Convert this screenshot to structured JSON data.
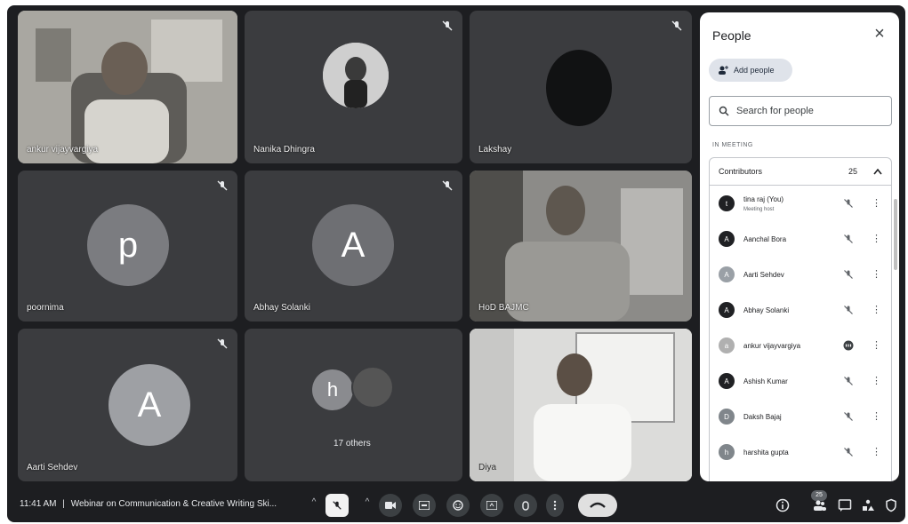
{
  "tiles": [
    {
      "name": "ankur vijayvargiya"
    },
    {
      "name": "Nanika Dhingra"
    },
    {
      "name": "Lakshay"
    },
    {
      "name": "poornima",
      "initial": "p"
    },
    {
      "name": "Abhay Solanki",
      "initial": "A"
    },
    {
      "name": "HoD BAJMC"
    },
    {
      "name": "Aarti Sehdev",
      "initial": "A"
    },
    {
      "name": "17 others",
      "initial": "h"
    },
    {
      "name": "Diya"
    }
  ],
  "people_panel": {
    "title": "People",
    "close": "×",
    "add_people": "Add people",
    "search_placeholder": "Search for people",
    "in_meeting": "IN MEETING",
    "section": "Contributors",
    "count": "25",
    "participants": [
      {
        "name": "tina raj (You)",
        "sub": "Meeting host",
        "initial": "t",
        "color": "#202124",
        "status": "muted"
      },
      {
        "name": "Aanchal Bora",
        "initial": "A",
        "color": "#202124",
        "status": "muted"
      },
      {
        "name": "Aarti Sehdev",
        "initial": "A",
        "color": "#9aa0a6",
        "status": "muted"
      },
      {
        "name": "Abhay Solanki",
        "initial": "A",
        "color": "#202124",
        "status": "muted"
      },
      {
        "name": "ankur vijayvargiya",
        "initial": "a",
        "color": "#b0b0b0",
        "status": "speaking"
      },
      {
        "name": "Ashish Kumar",
        "initial": "A",
        "color": "#202124",
        "status": "muted"
      },
      {
        "name": "Daksh Bajaj",
        "initial": "D",
        "color": "#80868b",
        "status": "muted"
      },
      {
        "name": "harshita gupta",
        "initial": "h",
        "color": "#80868b",
        "status": "muted"
      }
    ]
  },
  "bottom_bar": {
    "time": "11:41 AM",
    "separator": "|",
    "meeting_title": "Webinar on Communication & Creative Writing Ski...",
    "people_badge": "25"
  },
  "icons": {
    "mic_off": "mic-off-icon",
    "camera": "camera-icon",
    "captions": "captions-icon",
    "emoji": "emoji-icon",
    "present": "present-icon",
    "raise_hand": "raise-hand-icon",
    "more": "more-options-icon",
    "end_call": "end-call-icon",
    "info": "info-icon",
    "people": "people-icon",
    "chat": "chat-icon",
    "activities": "activities-icon",
    "host_controls": "host-controls-icon"
  }
}
